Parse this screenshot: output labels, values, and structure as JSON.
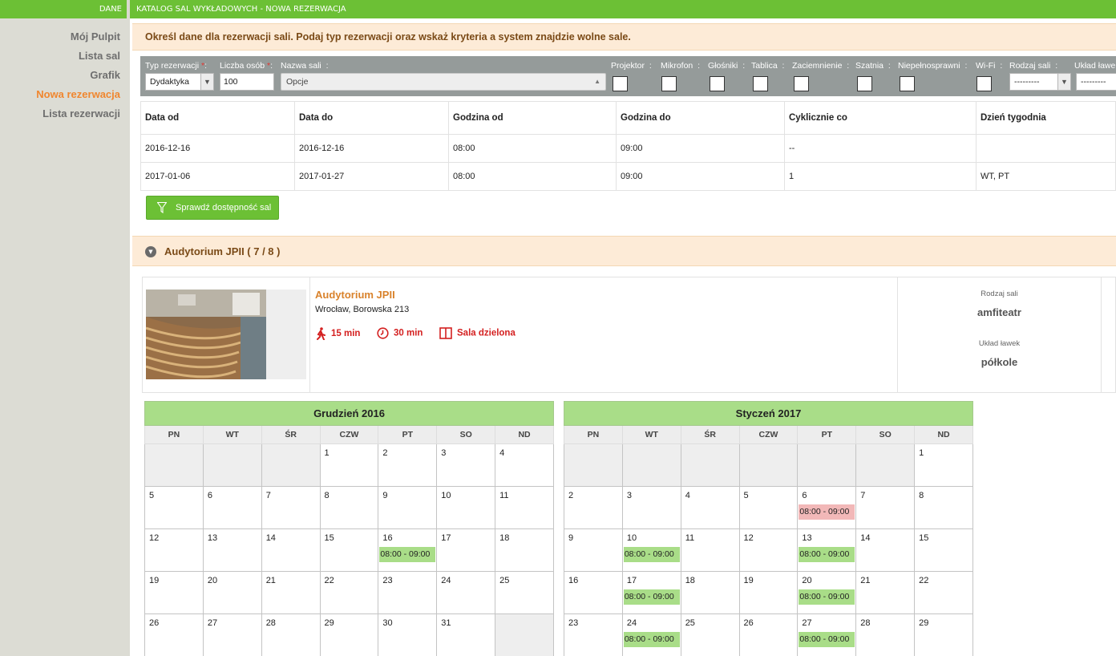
{
  "top": {
    "section_label": "DANE",
    "breadcrumb": "KATALOG SAL WYKŁADOWYCH - NOWA REZERWACJA"
  },
  "sidebar": {
    "items": [
      {
        "label": "Mój Pulpit",
        "active": false
      },
      {
        "label": "Lista sal",
        "active": false
      },
      {
        "label": "Grafik",
        "active": false
      },
      {
        "label": "Nowa rezerwacja",
        "active": true
      },
      {
        "label": "Lista rezerwacji",
        "active": false
      }
    ]
  },
  "info": {
    "text": "Określ dane dla rezerwacji sali. Podaj typ rezerwacji oraz wskaż kryteria a system znajdzie wolne sale."
  },
  "filters": {
    "type_label": "Typ rezerwacji",
    "type_value": "Dydaktyka",
    "people_label": "Liczba osób",
    "people_value": "100",
    "name_label": "Nazwa sali",
    "name_value": "Opcje",
    "required_mark": "*",
    "colon": ":",
    "checkboxes": [
      "Projektor",
      "Mikrofon",
      "Głośniki",
      "Tablica",
      "Zaciemnienie",
      "Szatnia",
      "Niepełnosprawni",
      "Wi-Fi"
    ],
    "room_type_label": "Rodzaj sali",
    "room_type_value": "---------",
    "bench_label": "Układ ławek",
    "bench_value": "---------"
  },
  "dates_table": {
    "headers": [
      "Data od",
      "Data do",
      "Godzina od",
      "Godzina do",
      "Cyklicznie co",
      "Dzień tygodnia"
    ],
    "rows": [
      [
        "2016-12-16",
        "2016-12-16",
        "08:00",
        "09:00",
        "--",
        ""
      ],
      [
        "2017-01-06",
        "2017-01-27",
        "08:00",
        "09:00",
        "1",
        "WT, PT"
      ]
    ]
  },
  "check_button": "Sprawdź dostępność sal",
  "room_section": {
    "title": "Audytorium JPII ( 7 / 8 )"
  },
  "room": {
    "name": "Audytorium JPII",
    "address": "Wrocław, Borowska 213",
    "walk_time": "15 min",
    "time": "30 min",
    "shared": "Sala dzielona",
    "type_label": "Rodzaj sali",
    "type_value": "amfiteatr",
    "bench_label": "Układ ławek",
    "bench_value": "półkole"
  },
  "calendars": [
    {
      "title": "Grudzień 2016",
      "days": [
        "PN",
        "WT",
        "ŚR",
        "CZW",
        "PT",
        "SO",
        "ND"
      ],
      "weeks": [
        [
          null,
          null,
          null,
          {
            "d": "1"
          },
          {
            "d": "2"
          },
          {
            "d": "3"
          },
          {
            "d": "4"
          }
        ],
        [
          {
            "d": "5"
          },
          {
            "d": "6"
          },
          {
            "d": "7"
          },
          {
            "d": "8"
          },
          {
            "d": "9"
          },
          {
            "d": "10"
          },
          {
            "d": "11"
          }
        ],
        [
          {
            "d": "12"
          },
          {
            "d": "13"
          },
          {
            "d": "14"
          },
          {
            "d": "15"
          },
          {
            "d": "16",
            "ev": "08:00 - 09:00",
            "status": "free"
          },
          {
            "d": "17"
          },
          {
            "d": "18"
          }
        ],
        [
          {
            "d": "19"
          },
          {
            "d": "20"
          },
          {
            "d": "21"
          },
          {
            "d": "22"
          },
          {
            "d": "23"
          },
          {
            "d": "24"
          },
          {
            "d": "25"
          }
        ],
        [
          {
            "d": "26"
          },
          {
            "d": "27"
          },
          {
            "d": "28"
          },
          {
            "d": "29"
          },
          {
            "d": "30"
          },
          {
            "d": "31"
          },
          null
        ]
      ]
    },
    {
      "title": "Styczeń 2017",
      "days": [
        "PN",
        "WT",
        "ŚR",
        "CZW",
        "PT",
        "SO",
        "ND"
      ],
      "weeks": [
        [
          null,
          null,
          null,
          null,
          null,
          null,
          {
            "d": "1"
          }
        ],
        [
          {
            "d": "2"
          },
          {
            "d": "3"
          },
          {
            "d": "4"
          },
          {
            "d": "5"
          },
          {
            "d": "6",
            "ev": "08:00 - 09:00",
            "status": "busy"
          },
          {
            "d": "7"
          },
          {
            "d": "8"
          }
        ],
        [
          {
            "d": "9"
          },
          {
            "d": "10",
            "ev": "08:00 - 09:00",
            "status": "free"
          },
          {
            "d": "11"
          },
          {
            "d": "12"
          },
          {
            "d": "13",
            "ev": "08:00 - 09:00",
            "status": "free"
          },
          {
            "d": "14"
          },
          {
            "d": "15"
          }
        ],
        [
          {
            "d": "16"
          },
          {
            "d": "17",
            "ev": "08:00 - 09:00",
            "status": "free"
          },
          {
            "d": "18"
          },
          {
            "d": "19"
          },
          {
            "d": "20",
            "ev": "08:00 - 09:00",
            "status": "free"
          },
          {
            "d": "21"
          },
          {
            "d": "22"
          }
        ],
        [
          {
            "d": "23"
          },
          {
            "d": "24",
            "ev": "08:00 - 09:00",
            "status": "free"
          },
          {
            "d": "25"
          },
          {
            "d": "26"
          },
          {
            "d": "27",
            "ev": "08:00 - 09:00",
            "status": "free"
          },
          {
            "d": "28"
          },
          {
            "d": "29"
          }
        ]
      ]
    }
  ],
  "colors": {
    "brand_green": "#6cc035",
    "accent_orange": "#f0862e",
    "free_slot": "#a9dd88",
    "busy_slot": "#f2b8b8",
    "alert_red": "#d42020"
  }
}
